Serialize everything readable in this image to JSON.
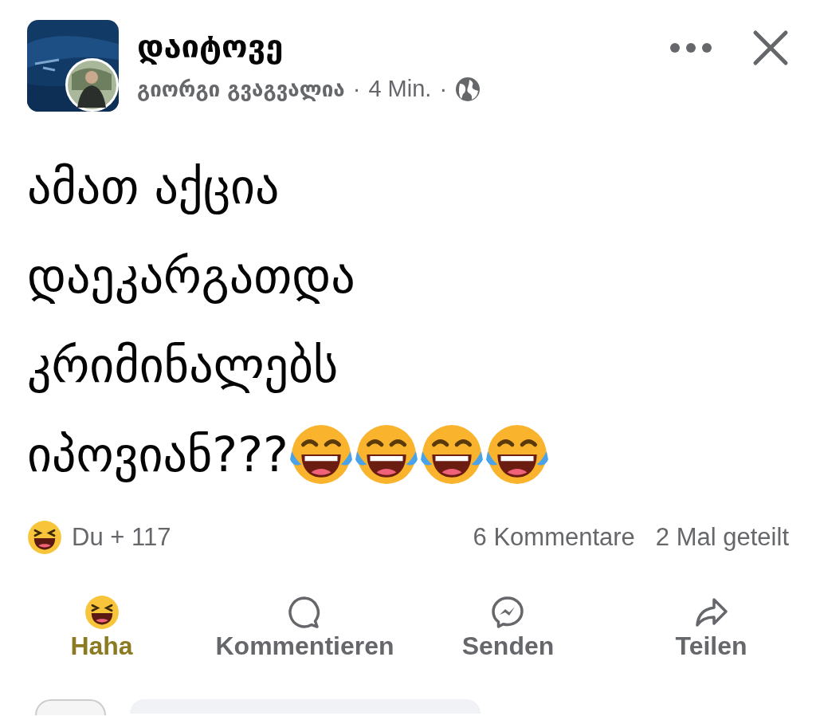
{
  "group": {
    "name": "დაიტოვე",
    "author": "გიორგი გვაგვალია",
    "separator_1": "·",
    "time": "4 Min.",
    "separator_2": "·"
  },
  "post": {
    "lines": [
      "ამათ აქცია",
      "დაეკარგათდა",
      "კრიმინალებს",
      "იპოვიან???"
    ],
    "emojis": [
      {
        "kind": "tears_of_joy"
      },
      {
        "kind": "tears_of_joy"
      },
      {
        "kind": "tears_of_joy"
      },
      {
        "kind": "tears_of_joy"
      }
    ]
  },
  "stats": {
    "reactions": "Du + 117",
    "comments": "6 Kommentare",
    "shares": "2 Mal geteilt"
  },
  "actions": [
    {
      "kind": "haha",
      "label": "Haha",
      "selected": true
    },
    {
      "kind": "comment",
      "label": "Kommentieren",
      "selected": false
    },
    {
      "kind": "send",
      "label": "Senden",
      "selected": false
    },
    {
      "kind": "share",
      "label": "Teilen",
      "selected": false
    }
  ]
}
